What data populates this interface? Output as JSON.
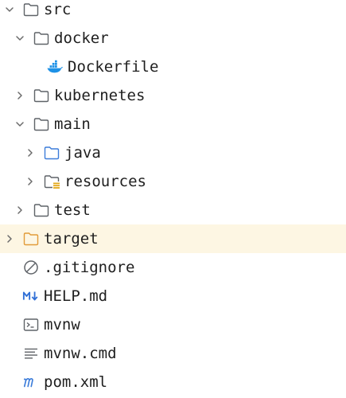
{
  "colors": {
    "folder": "#5f6368",
    "source_folder": "#3d7dda",
    "resources_mark": "#e3a81a",
    "excluded_folder": "#e29b39",
    "excluded_bg": "#fdf6e3",
    "docker": "#1d91e6",
    "markdown": "#2f6fd6",
    "maven": "#3d7dda",
    "text": "#1f1f1f",
    "chevron": "#6b6b6b"
  },
  "tree": [
    {
      "label": "src",
      "expanded": true,
      "icon": "folder-icon"
    },
    {
      "label": "docker",
      "expanded": true,
      "icon": "folder-icon"
    },
    {
      "label": "Dockerfile",
      "icon": "docker-icon"
    },
    {
      "label": "kubernetes",
      "expanded": false,
      "icon": "folder-icon"
    },
    {
      "label": "main",
      "expanded": true,
      "icon": "folder-icon"
    },
    {
      "label": "java",
      "expanded": false,
      "icon": "source-folder-icon"
    },
    {
      "label": "resources",
      "expanded": false,
      "icon": "resources-folder-icon"
    },
    {
      "label": "test",
      "expanded": false,
      "icon": "folder-icon"
    },
    {
      "label": "target",
      "expanded": false,
      "icon": "excluded-folder-icon",
      "highlighted": true
    },
    {
      "label": ".gitignore",
      "icon": "ignore-file-icon"
    },
    {
      "label": "HELP.md",
      "icon": "markdown-icon"
    },
    {
      "label": "mvnw",
      "icon": "terminal-icon"
    },
    {
      "label": "mvnw.cmd",
      "icon": "text-file-icon"
    },
    {
      "label": "pom.xml",
      "icon": "maven-icon"
    }
  ]
}
